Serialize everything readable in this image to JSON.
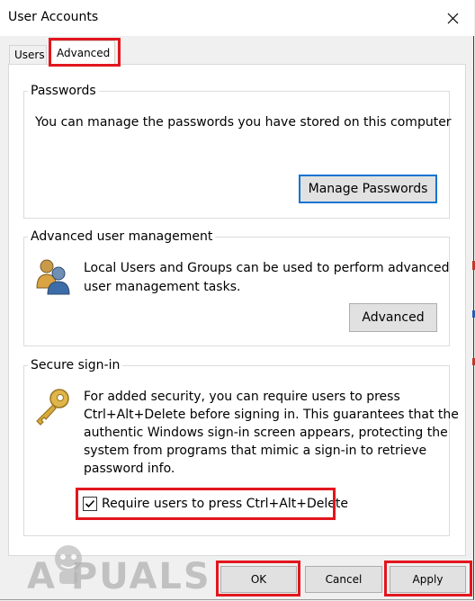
{
  "window": {
    "title": "User Accounts"
  },
  "tabs": [
    {
      "label": "Users",
      "selected": false
    },
    {
      "label": "Advanced",
      "selected": true
    }
  ],
  "passwords": {
    "heading": "Passwords",
    "description": "You can manage the passwords you have stored on this computer",
    "button_label": "Manage Passwords"
  },
  "advanced_management": {
    "heading": "Advanced user management",
    "description_line1": "Local Users and Groups can be used to perform advanced",
    "description_line2": "user management tasks.",
    "button_label": "Advanced",
    "icon": "users-group-icon"
  },
  "secure_signin": {
    "heading": "Secure sign-in",
    "lines": [
      "For added security, you can require users to press",
      "Ctrl+Alt+Delete before signing in. This guarantees that the",
      "authentic Windows sign-in screen appears, protecting the",
      "system from programs that mimic a sign-in to retrieve",
      "password info."
    ],
    "checkbox_label": "Require users to press Ctrl+Alt+Delete",
    "checkbox_checked": true,
    "icon": "key-icon"
  },
  "footer": {
    "ok_label": "OK",
    "cancel_label": "Cancel",
    "apply_label": "Apply"
  },
  "watermark": "A  PUALS",
  "colors": {
    "highlight": "#e2161e",
    "focus_border": "#0a74d2"
  }
}
